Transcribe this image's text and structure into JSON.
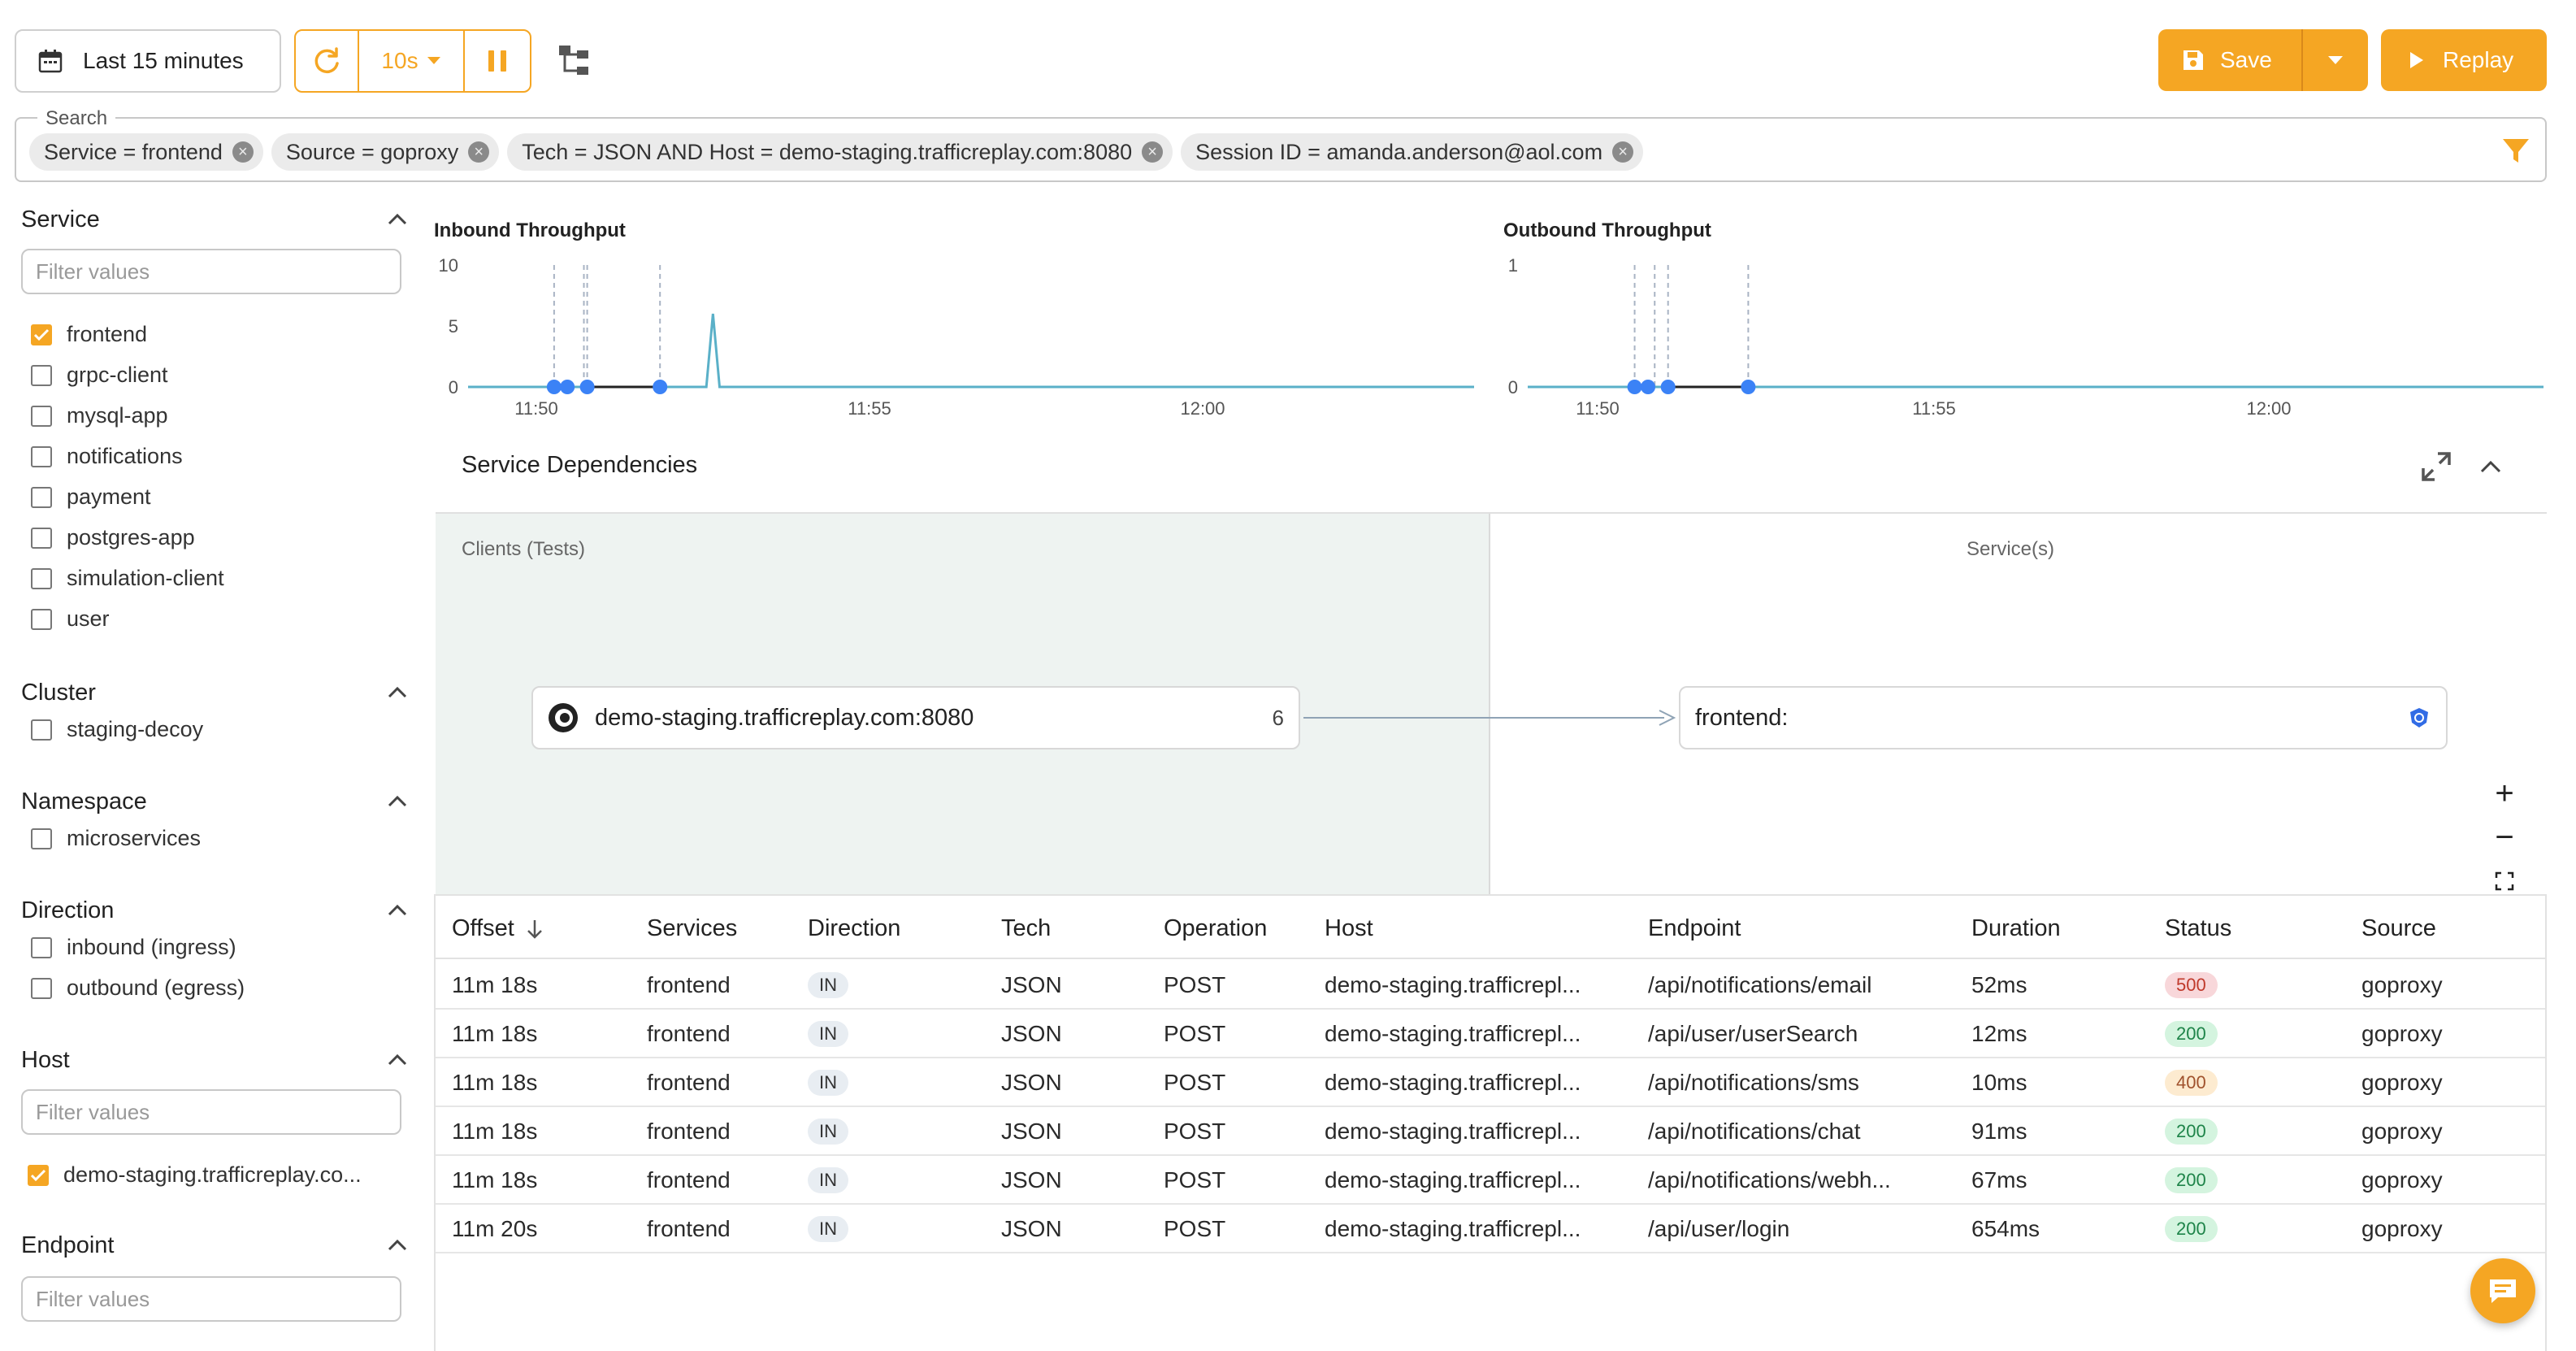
{
  "toolbar": {
    "time_range": "Last 15 minutes",
    "refresh_interval": "10s",
    "save_label": "Save",
    "replay_label": "Replay"
  },
  "search": {
    "label": "Search",
    "chips": [
      "Service = frontend",
      "Source = goproxy",
      "Tech = JSON AND Host = demo-staging.trafficreplay.com:8080",
      "Session ID = amanda.anderson@aol.com"
    ]
  },
  "sidebar": {
    "service": {
      "title": "Service",
      "placeholder": "Filter values",
      "items": [
        {
          "label": "frontend",
          "checked": true
        },
        {
          "label": "grpc-client",
          "checked": false
        },
        {
          "label": "mysql-app",
          "checked": false
        },
        {
          "label": "notifications",
          "checked": false
        },
        {
          "label": "payment",
          "checked": false
        },
        {
          "label": "postgres-app",
          "checked": false
        },
        {
          "label": "simulation-client",
          "checked": false
        },
        {
          "label": "user",
          "checked": false
        }
      ]
    },
    "cluster": {
      "title": "Cluster",
      "items": [
        {
          "label": "staging-decoy",
          "checked": false
        }
      ]
    },
    "namespace": {
      "title": "Namespace",
      "items": [
        {
          "label": "microservices",
          "checked": false
        }
      ]
    },
    "direction": {
      "title": "Direction",
      "items": [
        {
          "label": "inbound (ingress)",
          "checked": false
        },
        {
          "label": "outbound (egress)",
          "checked": false
        }
      ]
    },
    "host": {
      "title": "Host",
      "placeholder": "Filter values",
      "items": [
        {
          "label": "demo-staging.trafficreplay.co...",
          "checked": true
        }
      ]
    },
    "endpoint": {
      "title": "Endpoint",
      "placeholder": "Filter values"
    }
  },
  "charts": {
    "inbound": {
      "title": "Inbound Throughput"
    },
    "outbound": {
      "title": "Outbound Throughput"
    }
  },
  "chart_data": [
    {
      "type": "line",
      "title": "Inbound Throughput",
      "x_ticks": [
        "11:50",
        "11:55",
        "12:00"
      ],
      "y_ticks": [
        0,
        5,
        10
      ],
      "ylim": [
        0,
        10
      ],
      "x_start_min": 0,
      "x_end_min": 15.2,
      "series": [
        {
          "x": [
            0,
            3.6,
            3.7,
            3.8,
            3.9,
            15.2
          ],
          "y": [
            0,
            0,
            6,
            0,
            0,
            0
          ]
        }
      ],
      "markers_x": [
        1.3,
        1.5,
        1.8,
        2.9
      ],
      "dashed_x": [
        1.3,
        1.75,
        1.8,
        2.9
      ],
      "segment_x": [
        1.8,
        2.9
      ]
    },
    {
      "type": "line",
      "title": "Outbound Throughput",
      "x_ticks": [
        "11:50",
        "11:55",
        "12:00"
      ],
      "y_ticks": [
        0,
        1
      ],
      "ylim": [
        0,
        1
      ],
      "x_start_min": 0,
      "x_end_min": 15.2,
      "series": [
        {
          "x": [
            0,
            15.2
          ],
          "y": [
            0,
            0
          ]
        }
      ],
      "markers_x": [
        1.6,
        1.8,
        2.1,
        3.3
      ],
      "dashed_x": [
        1.6,
        1.9,
        2.1,
        3.3
      ],
      "segment_x": [
        2.1,
        3.3
      ]
    }
  ],
  "dependencies": {
    "title": "Service Dependencies",
    "clients_label": "Clients (Tests)",
    "services_label": "Service(s)",
    "client_node": {
      "label": "demo-staging.trafficreplay.com:8080",
      "count": "6"
    },
    "service_node": {
      "label": "frontend:"
    }
  },
  "table": {
    "headers": [
      "Offset",
      "Services",
      "Direction",
      "Tech",
      "Operation",
      "Host",
      "Endpoint",
      "Duration",
      "Status",
      "Source"
    ],
    "rows": [
      {
        "offset": "11m 18s",
        "service": "frontend",
        "direction": "IN",
        "tech": "JSON",
        "operation": "POST",
        "host": "demo-staging.trafficrepl...",
        "endpoint": "/api/notifications/email",
        "duration": "52ms",
        "status": "500",
        "status_color": "#f8d7da",
        "status_text": "#c0392b",
        "source": "goproxy"
      },
      {
        "offset": "11m 18s",
        "service": "frontend",
        "direction": "IN",
        "tech": "JSON",
        "operation": "POST",
        "host": "demo-staging.trafficrepl...",
        "endpoint": "/api/user/userSearch",
        "duration": "12ms",
        "status": "200",
        "status_color": "#d4f4df",
        "status_text": "#1e8449",
        "source": "goproxy"
      },
      {
        "offset": "11m 18s",
        "service": "frontend",
        "direction": "IN",
        "tech": "JSON",
        "operation": "POST",
        "host": "demo-staging.trafficrepl...",
        "endpoint": "/api/notifications/sms",
        "duration": "10ms",
        "status": "400",
        "status_color": "#fdebd0",
        "status_text": "#a0522d",
        "source": "goproxy"
      },
      {
        "offset": "11m 18s",
        "service": "frontend",
        "direction": "IN",
        "tech": "JSON",
        "operation": "POST",
        "host": "demo-staging.trafficrepl...",
        "endpoint": "/api/notifications/chat",
        "duration": "91ms",
        "status": "200",
        "status_color": "#d4f4df",
        "status_text": "#1e8449",
        "source": "goproxy"
      },
      {
        "offset": "11m 18s",
        "service": "frontend",
        "direction": "IN",
        "tech": "JSON",
        "operation": "POST",
        "host": "demo-staging.trafficrepl...",
        "endpoint": "/api/notifications/webh...",
        "duration": "67ms",
        "status": "200",
        "status_color": "#d4f4df",
        "status_text": "#1e8449",
        "source": "goproxy"
      },
      {
        "offset": "11m 20s",
        "service": "frontend",
        "direction": "IN",
        "tech": "JSON",
        "operation": "POST",
        "host": "demo-staging.trafficrepl...",
        "endpoint": "/api/user/login",
        "duration": "654ms",
        "status": "200",
        "status_color": "#d4f4df",
        "status_text": "#1e8449",
        "source": "goproxy"
      }
    ]
  },
  "colors": {
    "accent": "#f5a623",
    "line": "#5ab0c8",
    "marker": "#3b82f6"
  }
}
